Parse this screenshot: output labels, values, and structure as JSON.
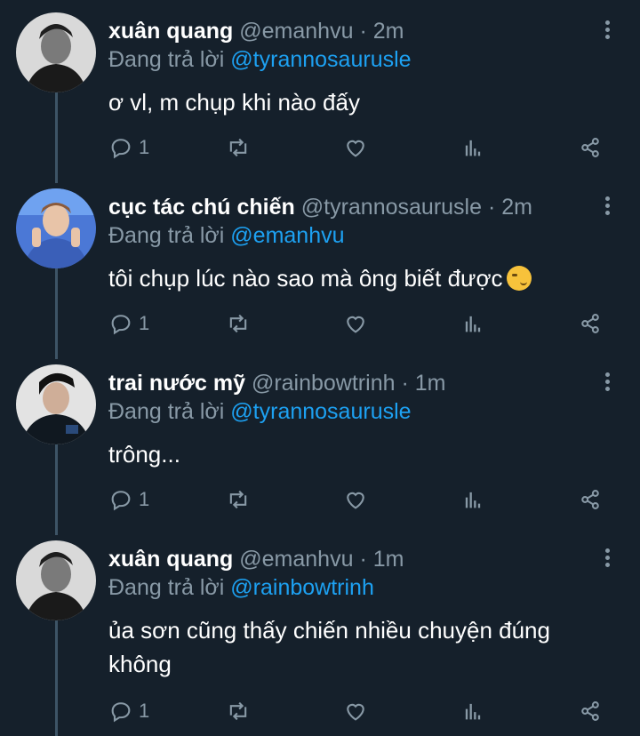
{
  "tweets": [
    {
      "name": "xuân quang",
      "handle": "@emanhvu",
      "time": "· 2m",
      "reply_prefix": "Đang trả lời",
      "reply_to": "@tyrannosaurusle",
      "text": "ơ vl, m chụp khi nào đấy",
      "reply_count": "1",
      "avatar": "avatar-xuan-quang"
    },
    {
      "name": "cục tác chú chiến",
      "handle": "@tyrannosaurusle",
      "time": "· 2m",
      "reply_prefix": "Đang trả lời",
      "reply_to": "@emanhvu",
      "text": "tôi chụp lúc nào sao mà ông biết được",
      "emoji": "smirking-face",
      "reply_count": "1",
      "avatar": "avatar-cuc-tac"
    },
    {
      "name": "trai nước mỹ",
      "handle": "@rainbowtrinh",
      "time": "· 1m",
      "reply_prefix": "Đang trả lời",
      "reply_to": "@tyrannosaurusle",
      "text": "trông...",
      "reply_count": "1",
      "avatar": "avatar-trai-nuoc-my"
    },
    {
      "name": "xuân quang",
      "handle": "@emanhvu",
      "time": "· 1m",
      "reply_prefix": "Đang trả lời",
      "reply_to": "@rainbowtrinh",
      "text_line1": "ủa sơn cũng thấy chiến nhiều chuyện đúng",
      "text_line2": "không",
      "reply_count": "1",
      "avatar": "avatar-xuan-quang"
    }
  ],
  "icons": [
    "reply-icon",
    "retweet-icon",
    "like-icon",
    "analytics-icon",
    "share-icon",
    "more-icon"
  ],
  "colors": {
    "background": "#15202b",
    "secondary": "#8899a6",
    "mention": "#1da1f2",
    "thread": "#3d5466"
  }
}
